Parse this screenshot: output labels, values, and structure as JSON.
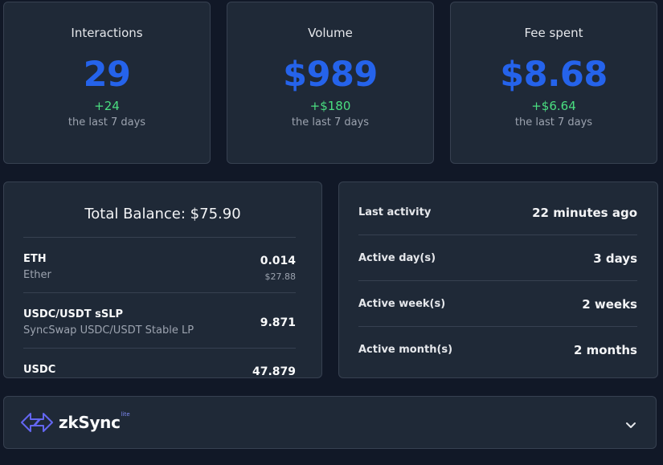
{
  "stats": [
    {
      "title": "Interactions",
      "value": "29",
      "delta": "+24",
      "sub": "the last 7 days"
    },
    {
      "title": "Volume",
      "value": "$989",
      "delta": "+$180",
      "sub": "the last 7 days"
    },
    {
      "title": "Fee spent",
      "value": "$8.68",
      "delta": "+$6.64",
      "sub": "the last 7 days"
    }
  ],
  "balance": {
    "title": "Total Balance: $75.90",
    "tokens": [
      {
        "symbol": "ETH",
        "name": "Ether",
        "amount": "0.014",
        "usd": "$27.88"
      },
      {
        "symbol": "USDC/USDT sSLP",
        "name": "SyncSwap USDC/USDT Stable LP",
        "amount": "9.871"
      },
      {
        "symbol": "USDC",
        "amount": "47.879"
      }
    ]
  },
  "activity": [
    {
      "label": "Last activity",
      "value": "22 minutes ago"
    },
    {
      "label": "Active day(s)",
      "value": "3 days"
    },
    {
      "label": "Active week(s)",
      "value": "2 weeks"
    },
    {
      "label": "Active month(s)",
      "value": "2 months"
    }
  ],
  "footer": {
    "logo_text": "zkSync",
    "logo_sup": "lite",
    "logo_icon": "zksync-logo-icon",
    "toggle_icon": "chevron-down-icon"
  },
  "colors": {
    "background": "#111827",
    "card": "#1f2937",
    "accent": "#2563eb",
    "positive": "#4ade80"
  }
}
